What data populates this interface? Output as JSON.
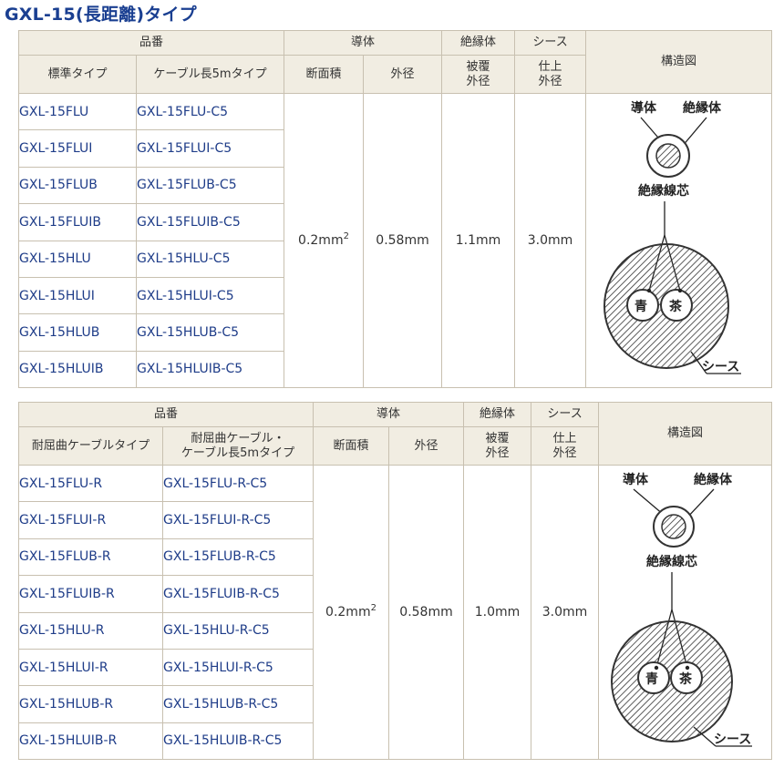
{
  "title": "GXL-15(長距離)タイプ",
  "headers": {
    "part_no": "品番",
    "conductor": "導体",
    "insulator": "絶縁体",
    "sheath": "シース",
    "structure": "構造図",
    "area": "断面積",
    "od": "外径",
    "coating_od": "被覆\n外径",
    "finish_od": "仕上\n外径"
  },
  "table1": {
    "col_standard": "標準タイプ",
    "col_5m": "ケーブル長5mタイプ",
    "rows": [
      {
        "std": "GXL-15FLU",
        "c5": "GXL-15FLU-C5"
      },
      {
        "std": "GXL-15FLUI",
        "c5": "GXL-15FLUI-C5"
      },
      {
        "std": "GXL-15FLUB",
        "c5": "GXL-15FLUB-C5"
      },
      {
        "std": "GXL-15FLUIB",
        "c5": "GXL-15FLUIB-C5"
      },
      {
        "std": "GXL-15HLU",
        "c5": "GXL-15HLU-C5"
      },
      {
        "std": "GXL-15HLUI",
        "c5": "GXL-15HLUI-C5"
      },
      {
        "std": "GXL-15HLUB",
        "c5": "GXL-15HLUB-C5"
      },
      {
        "std": "GXL-15HLUIB",
        "c5": "GXL-15HLUIB-C5"
      }
    ],
    "area_value": "0.2mm",
    "area_sup": "2",
    "od_value": "0.58mm",
    "coating_value": "1.1mm",
    "finish_value": "3.0mm"
  },
  "table2": {
    "col_flex": "耐屈曲ケーブルタイプ",
    "col_flex_5m": "耐屈曲ケーブル・\nケーブル長5mタイプ",
    "rows": [
      {
        "std": "GXL-15FLU-R",
        "c5": "GXL-15FLU-R-C5"
      },
      {
        "std": "GXL-15FLUI-R",
        "c5": "GXL-15FLUI-R-C5"
      },
      {
        "std": "GXL-15FLUB-R",
        "c5": "GXL-15FLUB-R-C5"
      },
      {
        "std": "GXL-15FLUIB-R",
        "c5": "GXL-15FLUIB-R-C5"
      },
      {
        "std": "GXL-15HLU-R",
        "c5": "GXL-15HLU-R-C5"
      },
      {
        "std": "GXL-15HLUI-R",
        "c5": "GXL-15HLUI-R-C5"
      },
      {
        "std": "GXL-15HLUB-R",
        "c5": "GXL-15HLUB-R-C5"
      },
      {
        "std": "GXL-15HLUIB-R",
        "c5": "GXL-15HLUIB-R-C5"
      }
    ],
    "area_value": "0.2mm",
    "area_sup": "2",
    "od_value": "0.58mm",
    "coating_value": "1.0mm",
    "finish_value": "3.0mm"
  },
  "diagram": {
    "conductor": "導体",
    "insulator": "絶縁体",
    "core": "絶縁線芯",
    "blue": "青",
    "brown": "茶",
    "sheath": "シース"
  }
}
